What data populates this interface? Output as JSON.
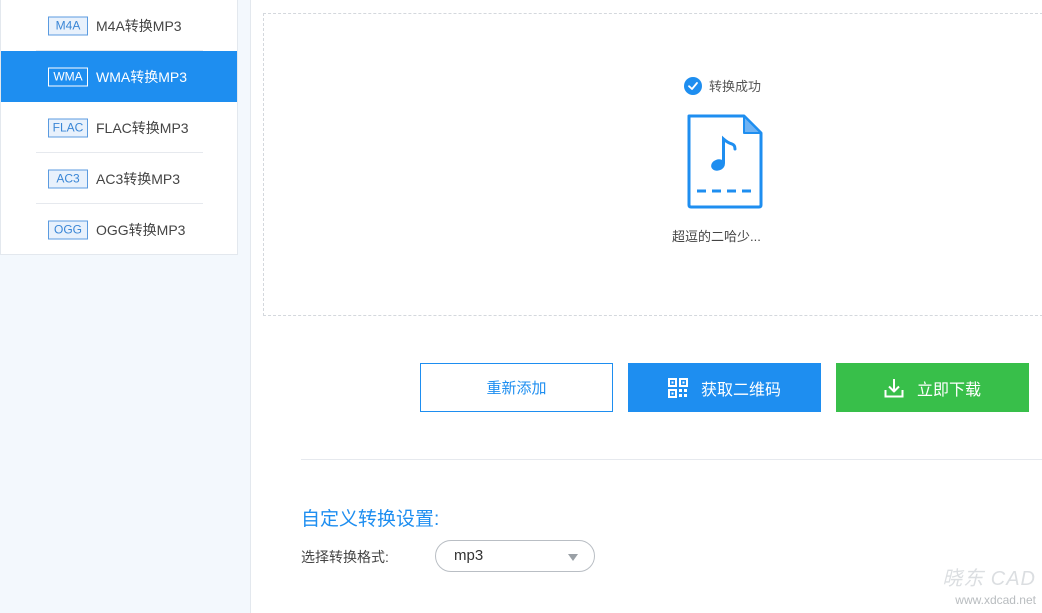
{
  "sidebar": {
    "items": [
      {
        "badge": "M4A",
        "label": "M4A转换MP3",
        "active": false
      },
      {
        "badge": "WMA",
        "label": "WMA转换MP3",
        "active": true
      },
      {
        "badge": "FLAC",
        "label": "FLAC转换MP3",
        "active": false
      },
      {
        "badge": "AC3",
        "label": "AC3转换MP3",
        "active": false
      },
      {
        "badge": "OGG",
        "label": "OGG转换MP3",
        "active": false
      }
    ]
  },
  "result": {
    "status_text": "转换成功",
    "status_icon": "check-circle-icon",
    "file_icon": "music-file-icon",
    "file_name": "超逗的二哈少..."
  },
  "actions": {
    "readd_label": "重新添加",
    "qrcode_label": "获取二维码",
    "download_label": "立即下载"
  },
  "settings": {
    "title": "自定义转换设置:",
    "format_label": "选择转换格式:",
    "format_value": "mp3"
  },
  "watermark": {
    "main": "晓东 CAD",
    "sub": "www.xdcad.net"
  },
  "colors": {
    "accent": "#1e8ef0",
    "success": "#38bf4a"
  }
}
